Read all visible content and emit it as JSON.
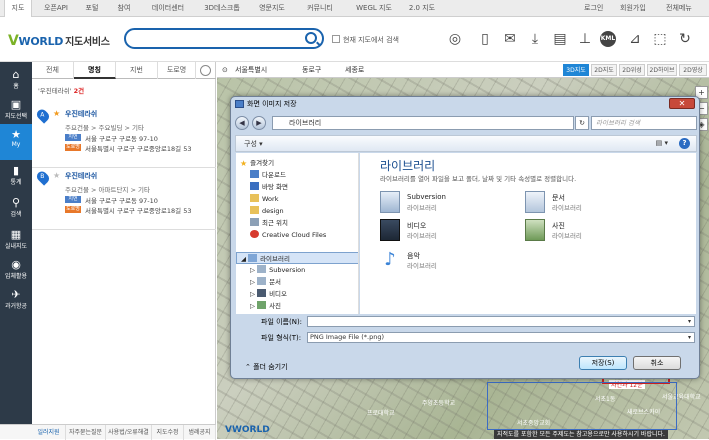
{
  "topnav": {
    "tabs": [
      "지도",
      "오픈API",
      "포털",
      "참여",
      "데이터센터",
      "3D데스크톱",
      "영문지도",
      "커뮤니티",
      "WEGL 지도",
      "2.0 지도"
    ],
    "right_links": [
      "로그인",
      "회원가입",
      "전체메뉴"
    ]
  },
  "header": {
    "logo_v": "V",
    "logo_world": "WORLD",
    "logo_korean": "지도서비스",
    "search_placeholder": "",
    "current_map_search": "현재 지도에서 검색",
    "tool_icons": [
      "binoculars-icon",
      "document-icon",
      "mail-icon",
      "download-icon",
      "print-icon",
      "ruler-icon",
      "kml-icon",
      "area-icon",
      "select-icon",
      "refresh-icon"
    ],
    "kml_label": "KML"
  },
  "sidebar": {
    "items": [
      {
        "icon": "⌂",
        "label": "홈"
      },
      {
        "icon": "▣",
        "label": "지도선택"
      },
      {
        "icon": "★",
        "label": "My"
      },
      {
        "icon": "▮",
        "label": "통계"
      },
      {
        "icon": "⚲",
        "label": "검색"
      },
      {
        "icon": "▦",
        "label": "실내지도"
      },
      {
        "icon": "◉",
        "label": "입체활용"
      },
      {
        "icon": "✈",
        "label": "과거항공"
      }
    ]
  },
  "panel": {
    "tabs": [
      "전체",
      "명칭",
      "지번",
      "도로명"
    ],
    "result_query": "'우진테라쉬'",
    "result_count_label": "2건",
    "results": [
      {
        "marker": "A",
        "name": "우진테라쉬",
        "category": "주요건물 > 주요빌딩 > 기타",
        "jibun_badge": "지번",
        "jibun": "서울 구로구 구로동 97-10",
        "road_badge": "도로명",
        "road": "서울특별시 구로구 구로중앙로18길 53"
      },
      {
        "marker": "B",
        "name": "우진테라쉬",
        "category": "주요건물 > 아파트단지 > 기타",
        "jibun_badge": "지번",
        "jibun": "서울 구로구 구로동 97-10",
        "road_badge": "도로명",
        "road": "서울특별시 구로구 구로중앙로18길 53"
      }
    ],
    "bottom_links": [
      "일러지원",
      "자주묻는질문",
      "사용법/오류해결",
      "지도수정",
      "범례공지"
    ]
  },
  "map": {
    "location": [
      "서울특별시",
      "동로구",
      "세종로"
    ],
    "map_types": [
      "3D지도",
      "2D지도",
      "2D위성",
      "2D하이브",
      "2D영상"
    ],
    "active_type": "3D지도",
    "labels": [
      "서울교육대학교",
      "주양초등학교",
      "새로브스카이",
      "서초1동",
      "프로대학교",
      "자연과 12분",
      "서초중앙교회"
    ],
    "notice": "지적도를 포함한 모든 주제도는 참고용으로만 사용하시기 바랍니다.",
    "logo": "VWORLD"
  },
  "dialog": {
    "title": "화면 이미지 저장",
    "close": "✕",
    "path": "라이브러리",
    "search_placeholder": "라이브러리 검색",
    "organize": "구성 ▾",
    "help": "?",
    "nav": {
      "favorites_label": "즐겨찾기",
      "favorites": [
        "다운로드",
        "바탕 화면",
        "Work",
        "design",
        "최근 위치",
        "Creative Cloud Files"
      ],
      "library_label": "라이브러리",
      "libraries": [
        "Subversion",
        "문서",
        "비디오",
        "사진"
      ]
    },
    "content_title": "라이브러리",
    "content_desc": "라이브러리를 열어 파일을 보고 폴더, 날짜 및 기타 속성별로 정렬합니다.",
    "items": [
      {
        "name": "Subversion",
        "sub": "라이브러리"
      },
      {
        "name": "문서",
        "sub": "라이브러리"
      },
      {
        "name": "비디오",
        "sub": "라이브러리"
      },
      {
        "name": "사진",
        "sub": "라이브러리"
      },
      {
        "name": "음악",
        "sub": "라이브러리"
      }
    ],
    "filename_label": "파일 이름(N):",
    "filename_value": "",
    "filetype_label": "파일 형식(T):",
    "filetype_value": "PNG Image File (*.png)",
    "hide_folders": "폴더 숨기기",
    "save": "저장(S)",
    "cancel": "취소"
  }
}
